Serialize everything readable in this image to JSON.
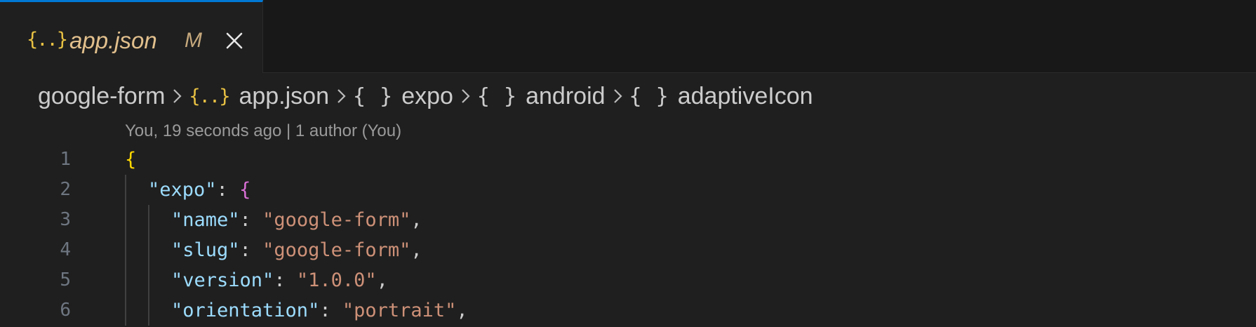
{
  "tab": {
    "icon": "{..}",
    "icon_name": "json-file-icon",
    "title": "app.json",
    "modified_badge": "M",
    "close_icon": "close-icon"
  },
  "breadcrumb": [
    {
      "label": "google-form",
      "icon": ""
    },
    {
      "label": "app.json",
      "icon": "{..}"
    },
    {
      "label": "expo",
      "icon": "{ }"
    },
    {
      "label": "android",
      "icon": "{ }"
    },
    {
      "label": "adaptiveIcon",
      "icon": "{ }"
    }
  ],
  "blame": "You, 19 seconds ago | 1 author (You)",
  "lines": [
    {
      "number": "1",
      "indent": 0,
      "tokens": [
        {
          "t": "brace1",
          "v": "{"
        }
      ]
    },
    {
      "number": "2",
      "indent": 1,
      "tokens": [
        {
          "t": "key",
          "v": "\"expo\""
        },
        {
          "t": "punc",
          "v": ": "
        },
        {
          "t": "brace2",
          "v": "{"
        }
      ]
    },
    {
      "number": "3",
      "indent": 2,
      "tokens": [
        {
          "t": "key",
          "v": "\"name\""
        },
        {
          "t": "punc",
          "v": ": "
        },
        {
          "t": "str",
          "v": "\"google-form\""
        },
        {
          "t": "punc",
          "v": ","
        }
      ]
    },
    {
      "number": "4",
      "indent": 2,
      "tokens": [
        {
          "t": "key",
          "v": "\"slug\""
        },
        {
          "t": "punc",
          "v": ": "
        },
        {
          "t": "str",
          "v": "\"google-form\""
        },
        {
          "t": "punc",
          "v": ","
        }
      ]
    },
    {
      "number": "5",
      "indent": 2,
      "tokens": [
        {
          "t": "key",
          "v": "\"version\""
        },
        {
          "t": "punc",
          "v": ": "
        },
        {
          "t": "str",
          "v": "\"1.0.0\""
        },
        {
          "t": "punc",
          "v": ","
        }
      ]
    },
    {
      "number": "6",
      "indent": 2,
      "tokens": [
        {
          "t": "key",
          "v": "\"orientation\""
        },
        {
          "t": "punc",
          "v": ": "
        },
        {
          "t": "str",
          "v": "\"portrait\""
        },
        {
          "t": "punc",
          "v": ","
        }
      ]
    }
  ],
  "colors": {
    "background": "#1f1f1f",
    "tab_bar": "#181818",
    "active_tab_border": "#0078d4",
    "modified_text": "#e2c08d",
    "json_icon": "#e8c143",
    "key": "#9cdcfe",
    "string": "#ce9178",
    "brace_level1": "#ffd700",
    "brace_level2": "#da70d6",
    "line_number": "#6e7681"
  }
}
